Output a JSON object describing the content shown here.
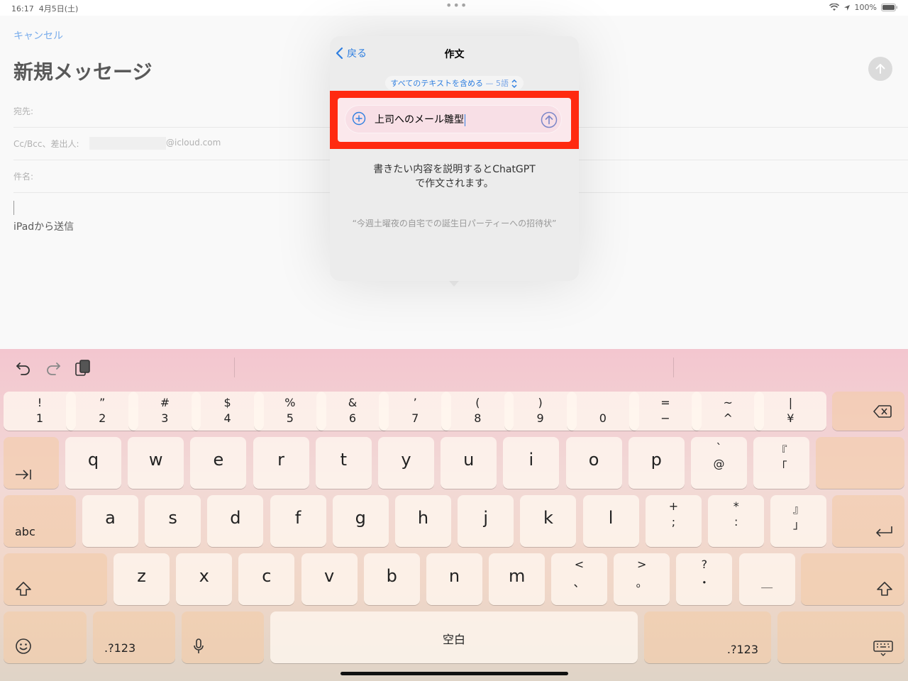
{
  "status": {
    "time": "16:17",
    "date": "4月5日(土)",
    "battery": "100%"
  },
  "compose": {
    "cancel_label": "キャンセル",
    "title": "新規メッセージ",
    "to_label": "宛先:",
    "cc_label": "Cc/Bcc、差出人:",
    "from_domain": "@icloud.com",
    "subject_label": "件名:",
    "signature": "iPadから送信"
  },
  "popover": {
    "back_label": "戻る",
    "title": "作文",
    "scope_label": "すべてのテキストを含める",
    "scope_count": "— 5語",
    "prompt_value": "上司へのメール雛型",
    "description_line1": "書きたい内容を説明するとChatGPT",
    "description_line2": "で作文されます。",
    "example": "“今週土曜夜の自宅での誕生日パーティーへの招待状”"
  },
  "keyboard": {
    "row1": [
      {
        "top": "!",
        "bottom": "1"
      },
      {
        "top": "”",
        "bottom": "2"
      },
      {
        "top": "#",
        "bottom": "3"
      },
      {
        "top": "$",
        "bottom": "4"
      },
      {
        "top": "%",
        "bottom": "5"
      },
      {
        "top": "&",
        "bottom": "6"
      },
      {
        "top": "’",
        "bottom": "7"
      },
      {
        "top": "(",
        "bottom": "8"
      },
      {
        "top": ")",
        "bottom": "9"
      },
      {
        "top": "",
        "bottom": "0"
      },
      {
        "top": "=",
        "bottom": "−"
      },
      {
        "top": "~",
        "bottom": "^"
      },
      {
        "top": "|",
        "bottom": "¥"
      }
    ],
    "row2": [
      "q",
      "w",
      "e",
      "r",
      "t",
      "y",
      "u",
      "i",
      "o",
      "p"
    ],
    "row2_extra": [
      {
        "top": "`",
        "bottom": "@"
      },
      {
        "top": "『",
        "bottom": "「"
      }
    ],
    "row3": [
      "a",
      "s",
      "d",
      "f",
      "g",
      "h",
      "j",
      "k",
      "l"
    ],
    "row3_extra": [
      {
        "top": "+",
        "bottom": ";"
      },
      {
        "top": "*",
        "bottom": ":"
      },
      {
        "top": "』",
        "bottom": "」"
      }
    ],
    "row4": [
      "z",
      "x",
      "c",
      "v",
      "b",
      "n",
      "m"
    ],
    "row4_extra": [
      {
        "top": "<",
        "bottom": "、"
      },
      {
        "top": ">",
        "bottom": "。"
      },
      {
        "top": "?",
        "bottom": "・"
      },
      {
        "top": "",
        "bottom": "＿"
      }
    ],
    "abc_label": "abc",
    "numbers_left": ".?123",
    "numbers_right": ".?123",
    "space_label": "空白"
  },
  "colors": {
    "accent": "#2f7fe0",
    "highlight": "#ff2a10"
  }
}
